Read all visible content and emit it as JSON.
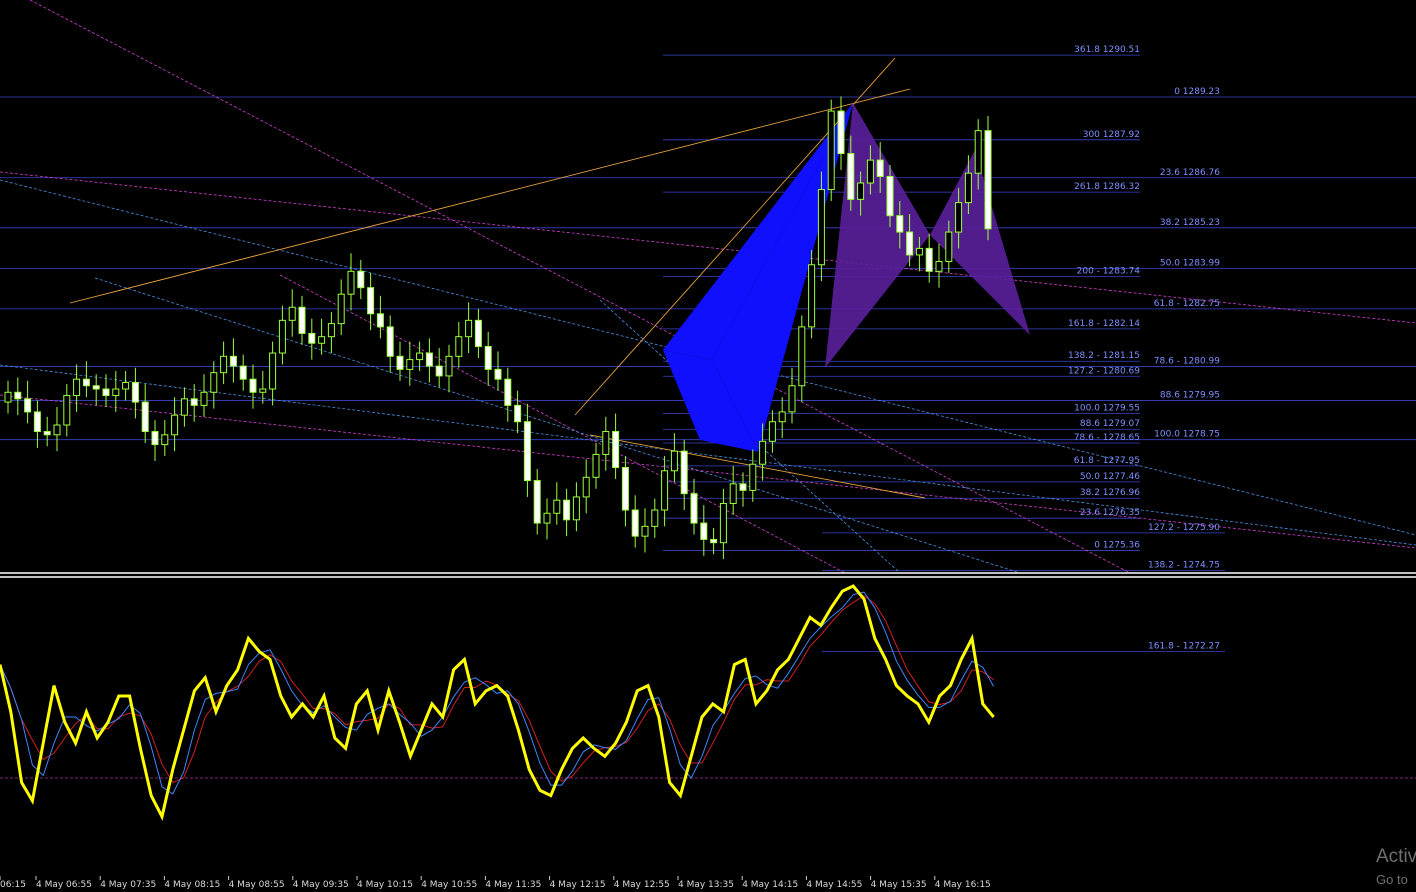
{
  "chart_data": {
    "type": "candlestick",
    "price_range": [
      1271.5,
      1293.8
    ],
    "time_labels": [
      "06:15",
      "4 May 06:55",
      "4 May 07:35",
      "4 May 08:15",
      "4 May 08:55",
      "4 May 09:35",
      "4 May 10:15",
      "4 May 10:55",
      "4 May 11:35",
      "4 May 12:15",
      "4 May 12:55",
      "4 May 13:35",
      "4 May 14:15",
      "4 May 14:55",
      "4 May 15:35",
      "4 May 16:15"
    ],
    "closes": [
      1280.2,
      1280.0,
      1279.6,
      1279.0,
      1278.9,
      1279.2,
      1280.1,
      1280.6,
      1280.4,
      1280.3,
      1280.1,
      1280.3,
      1280.5,
      1279.9,
      1279.0,
      1278.6,
      1278.9,
      1279.5,
      1280.0,
      1279.8,
      1280.2,
      1280.8,
      1281.3,
      1281.0,
      1280.6,
      1280.2,
      1280.3,
      1281.4,
      1282.4,
      1282.8,
      1282.0,
      1281.7,
      1281.9,
      1282.3,
      1283.2,
      1283.9,
      1283.4,
      1282.6,
      1282.2,
      1281.3,
      1280.9,
      1281.2,
      1281.4,
      1281.0,
      1280.7,
      1281.3,
      1281.9,
      1282.4,
      1281.6,
      1280.9,
      1280.6,
      1279.8,
      1279.3,
      1277.5,
      1276.2,
      1276.5,
      1276.9,
      1276.3,
      1277.0,
      1277.6,
      1278.3,
      1279.0,
      1277.9,
      1276.6,
      1275.8,
      1276.1,
      1276.6,
      1277.8,
      1278.4,
      1277.1,
      1276.2,
      1275.7,
      1275.6,
      1276.8,
      1277.4,
      1277.2,
      1278.0,
      1278.7,
      1279.3,
      1279.6,
      1280.4,
      1282.2,
      1284.1,
      1286.4,
      1288.8,
      1287.5,
      1286.1,
      1286.6,
      1287.3,
      1286.8,
      1285.6,
      1285.1,
      1284.4,
      1284.6,
      1283.9,
      1284.2,
      1285.1,
      1286.0,
      1286.9,
      1288.2,
      1285.2
    ],
    "fib_levels_left": [
      "0 1289.23",
      "23.6 1286.76",
      "38.2 1285.23",
      "50.0 1283.99",
      "61.8 - 1282.75",
      "78.6 - 1280.99",
      "88.6 1279.95",
      "100.0 1278.75"
    ],
    "fib_levels_mid": [
      "361.8 1290.51",
      "300 1287.92",
      "261.8 1286.32",
      "200 - 1283.74",
      "161.8 - 1282.14",
      "138.2 - 1281.15",
      "127.2 - 1280.69",
      "100.0 1279.55",
      "88.6 1279.07",
      "78.6 - 1278.65",
      "61.8 - 1277.95",
      "50.0 1277.46",
      "38.2 1276.96",
      "23.6 1276.35",
      "0 1275.36"
    ],
    "fib_levels_right": [
      "127.2 - 1275.90",
      "138.2 - 1274.75",
      "161.8 - 1272.27"
    ],
    "oscillator_range": [
      0,
      100
    ],
    "oscillator_main": [
      70,
      52,
      25,
      18,
      40,
      62,
      48,
      40,
      52,
      42,
      48,
      58,
      58,
      38,
      20,
      12,
      30,
      45,
      60,
      65,
      52,
      62,
      68,
      80,
      75,
      72,
      58,
      50,
      55,
      50,
      58,
      42,
      38,
      55,
      60,
      45,
      60,
      48,
      35,
      45,
      55,
      50,
      68,
      72,
      55,
      60,
      62,
      58,
      45,
      30,
      22,
      20,
      30,
      38,
      42,
      38,
      35,
      40,
      48,
      60,
      62,
      50,
      25,
      20,
      35,
      50,
      55,
      52,
      70,
      72,
      55,
      60,
      68,
      72,
      80,
      88,
      85,
      92,
      98,
      100,
      95,
      80,
      72,
      62,
      58,
      55,
      48,
      58,
      62,
      72,
      80,
      55,
      50
    ]
  },
  "watermark": {
    "line1": "Activ",
    "line2": "Go to"
  }
}
